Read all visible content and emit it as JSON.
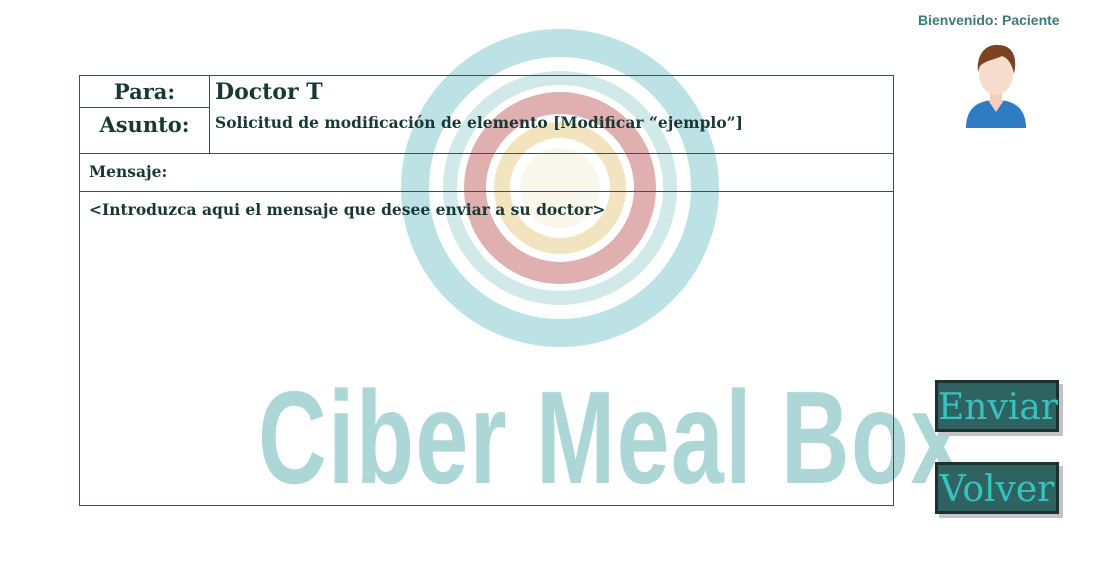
{
  "header": {
    "welcome": "Bienvenido: Paciente"
  },
  "watermark": {
    "brand": "Ciber Meal Box"
  },
  "form": {
    "to_label": "Para:",
    "to_value": "Doctor T",
    "subject_label": "Asunto:",
    "subject_value": "Solicitud de modificación de elemento  [Modificar “ejemplo”]",
    "message_label": "Mensaje:",
    "message_placeholder": "<Introduzca aqui el mensaje que desee enviar a su doctor>"
  },
  "buttons": {
    "send": "Enviar",
    "back": "Volver"
  },
  "colors": {
    "button_bg": "#2e6362",
    "button_text": "#37c1bf",
    "welcome_text": "#3c7a7a",
    "form_border": "#37524f"
  }
}
